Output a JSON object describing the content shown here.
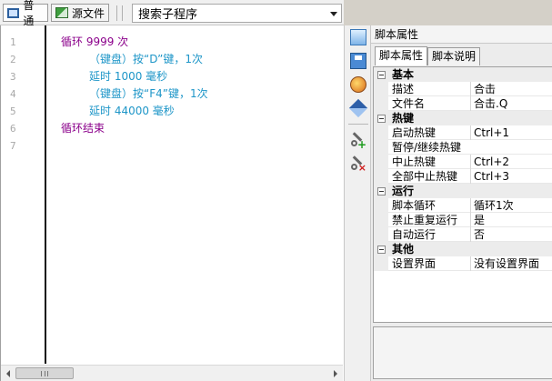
{
  "toolbar": {
    "tabs": [
      {
        "label": "普通",
        "icon": "grid-icon"
      },
      {
        "label": "源文件",
        "icon": "source-file-icon"
      }
    ],
    "search_combo": "搜索子程序"
  },
  "editor": {
    "line_numbers": [
      "1",
      "2",
      "3",
      "4",
      "5",
      "6",
      "7"
    ],
    "lines": [
      {
        "text": "循环 9999 次",
        "color": "#8b008b"
      },
      {
        "text": "（键盘）按“D”键，1次",
        "color": "#1e96c8"
      },
      {
        "text": "延时 1000 毫秒",
        "color": "#1e96c8"
      },
      {
        "text": "（键盘）按“F4”键，1次",
        "color": "#1e96c8"
      },
      {
        "text": "延时 44000 毫秒",
        "color": "#1e96c8"
      },
      {
        "text": "循环结束",
        "color": "#8b008b"
      },
      {
        "text": "",
        "color": "#000000"
      }
    ]
  },
  "panel": {
    "title": "脚本属性",
    "tabs": [
      "脚本属性",
      "脚本说明"
    ],
    "categories": [
      {
        "name": "基本",
        "props": [
          {
            "name": "描述",
            "value": "合击"
          },
          {
            "name": "文件名",
            "value": "合击.Q"
          }
        ]
      },
      {
        "name": "热键",
        "props": [
          {
            "name": "启动热键",
            "value": "Ctrl+1"
          },
          {
            "name": "暂停/继续热键",
            "value": ""
          },
          {
            "name": "中止热键",
            "value": "Ctrl+2"
          },
          {
            "name": "全部中止热键",
            "value": "Ctrl+3"
          }
        ]
      },
      {
        "name": "运行",
        "props": [
          {
            "name": "脚本循环",
            "value": "循环1次"
          },
          {
            "name": "禁止重复运行",
            "value": "是"
          },
          {
            "name": "自动运行",
            "value": "否"
          }
        ]
      },
      {
        "name": "其他",
        "props": [
          {
            "name": "设置界面",
            "value": "没有设置界面"
          }
        ]
      }
    ]
  }
}
